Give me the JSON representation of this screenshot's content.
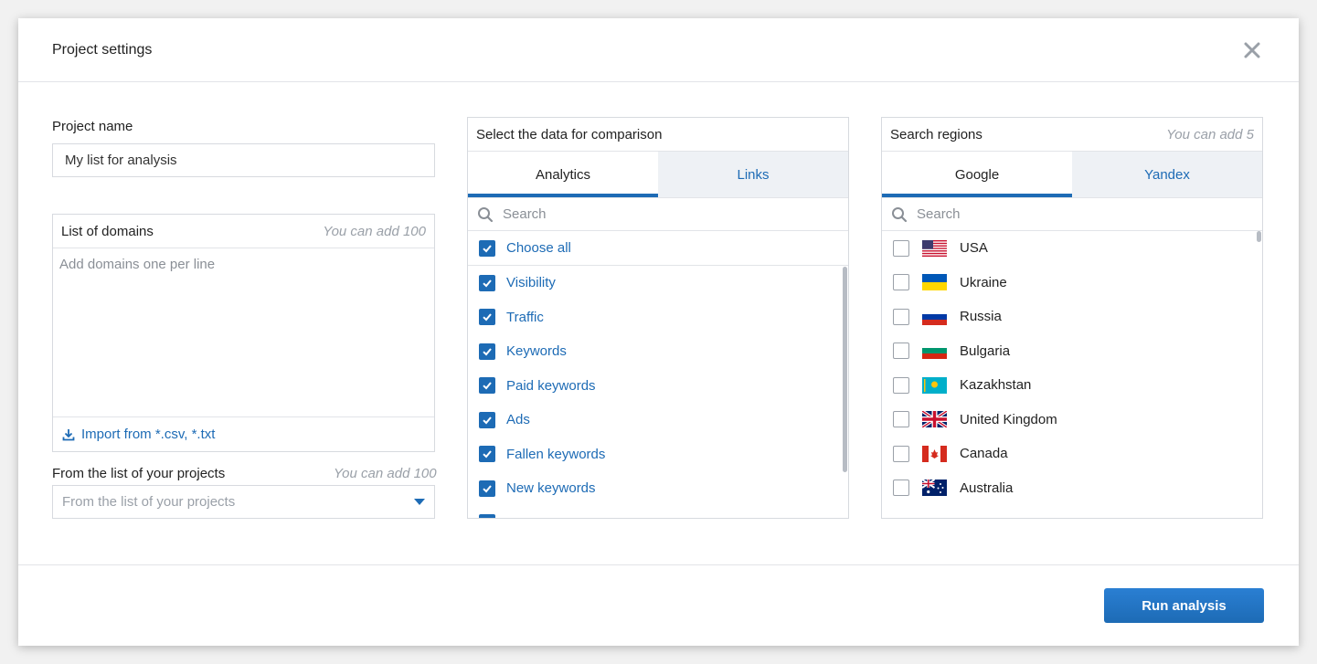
{
  "modal": {
    "title": "Project settings"
  },
  "project": {
    "label": "Project name",
    "value": "My list for analysis"
  },
  "domains": {
    "label": "List of domains",
    "hint": "You can add 100",
    "placeholder": "Add domains one per line",
    "import_label": "Import from *.csv, *.txt"
  },
  "projects": {
    "label": "From the list of your projects",
    "hint": "You can add 100",
    "placeholder": "From the list of your projects"
  },
  "comparison": {
    "title": "Select the data for comparison",
    "tabs": [
      "Analytics",
      "Links"
    ],
    "search_placeholder": "Search",
    "choose_all": "Choose all",
    "items": [
      "Visibility",
      "Traffic",
      "Keywords",
      "Paid keywords",
      "Ads",
      "Fallen keywords",
      "New keywords"
    ]
  },
  "regions": {
    "title": "Search regions",
    "hint": "You can add 5",
    "tabs": [
      "Google",
      "Yandex"
    ],
    "search_placeholder": "Search",
    "items": [
      "USA",
      "Ukraine",
      "Russia",
      "Bulgaria",
      "Kazakhstan",
      "United Kingdom",
      "Canada",
      "Australia"
    ],
    "flag_icons": [
      "flag-us-icon",
      "flag-ua-icon",
      "flag-ru-icon",
      "flag-bg-icon",
      "flag-kz-icon",
      "flag-gb-icon",
      "flag-ca-icon",
      "flag-au-icon"
    ]
  },
  "footer": {
    "run_label": "Run analysis"
  },
  "colors": {
    "accent": "#1d6bb5",
    "border": "#d7dadf",
    "tab_inactive_bg": "#eef1f5"
  }
}
